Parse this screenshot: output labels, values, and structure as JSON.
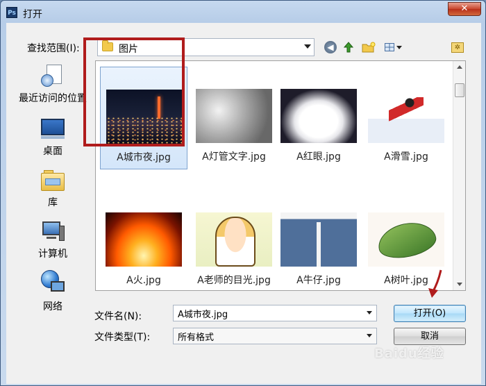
{
  "window": {
    "title": "打开",
    "app_icon_text": "Ps",
    "close_symbol": "✕"
  },
  "toolbar": {
    "lookin_label": "查找范围(I):",
    "lookin_value": "图片",
    "back_glyph": "◀"
  },
  "places": [
    {
      "label": "最近访问的位置"
    },
    {
      "label": "桌面"
    },
    {
      "label": "库"
    },
    {
      "label": "计算机"
    },
    {
      "label": "网络"
    }
  ],
  "files": [
    {
      "name": "A城市夜.jpg",
      "selected": true
    },
    {
      "name": "A灯管文字.jpg"
    },
    {
      "name": "A红眼.jpg"
    },
    {
      "name": "A滑雪.jpg"
    },
    {
      "name": "A火.jpg"
    },
    {
      "name": "A老师的目光.jpg"
    },
    {
      "name": "A牛仔.jpg"
    },
    {
      "name": "A树叶.jpg"
    }
  ],
  "bottom": {
    "filename_label": "文件名(N):",
    "filename_value": "A城市夜.jpg",
    "filetype_label": "文件类型(T):",
    "filetype_value": "所有格式",
    "open_button": "打开(O)",
    "cancel_button": "取消"
  },
  "colors": {
    "highlight_box": "#b01c1c",
    "annotation_arrow": "#b01c1c"
  },
  "watermark": "Baidu经验"
}
